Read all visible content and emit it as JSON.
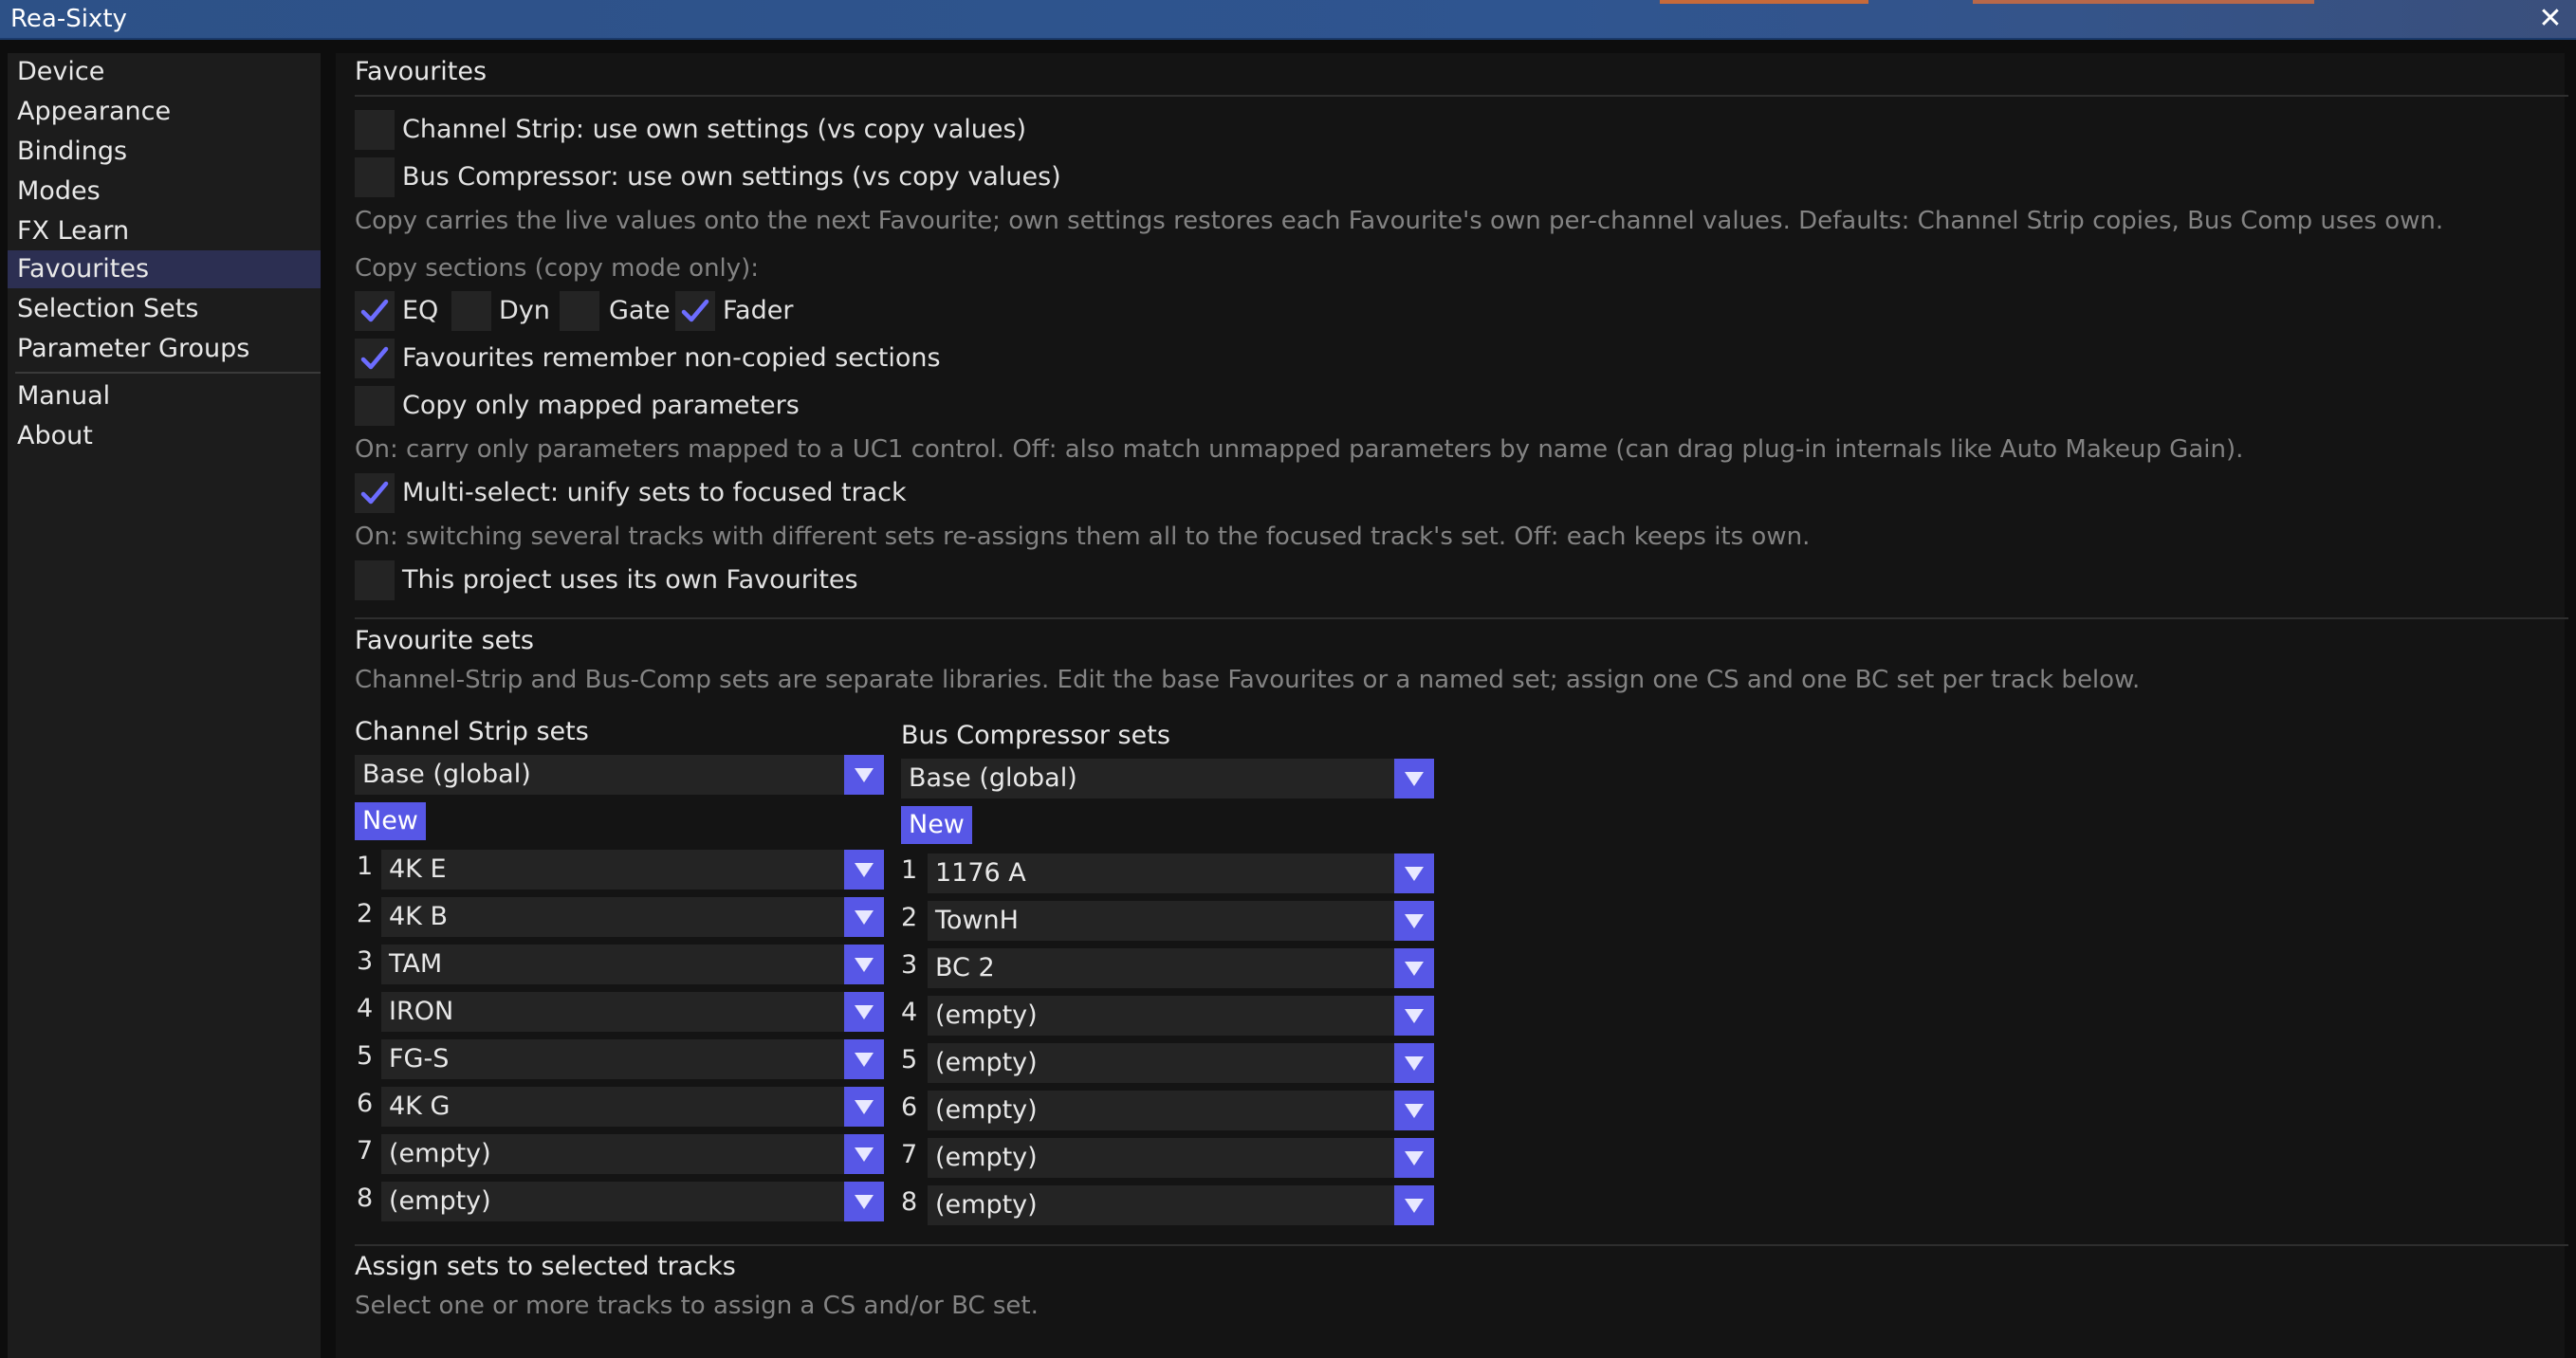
{
  "window": {
    "title": "Rea-Sixty",
    "close": "✕"
  },
  "sidebar": {
    "items": [
      {
        "id": "device",
        "label": "Device"
      },
      {
        "id": "appearance",
        "label": "Appearance"
      },
      {
        "id": "bindings",
        "label": "Bindings"
      },
      {
        "id": "modes",
        "label": "Modes"
      },
      {
        "id": "fx-learn",
        "label": "FX Learn"
      },
      {
        "id": "favourites",
        "label": "Favourites",
        "active": true
      },
      {
        "id": "selection-sets",
        "label": "Selection Sets"
      },
      {
        "id": "parameter-groups",
        "label": "Parameter Groups"
      },
      {
        "id": "manual",
        "label": "Manual"
      },
      {
        "id": "about",
        "label": "About"
      }
    ]
  },
  "favourites": {
    "heading": "Favourites",
    "cs_own": {
      "label": "Channel Strip: use own settings (vs copy values)",
      "checked": false
    },
    "bc_own": {
      "label": "Bus Compressor: use own settings (vs copy values)",
      "checked": false
    },
    "copy_desc": "Copy carries the live values onto the next Favourite; own settings restores each Favourite's own per-channel values. Defaults: Channel Strip copies, Bus Comp uses own.",
    "sections_heading": "Copy sections (copy mode only):",
    "sections": [
      {
        "id": "eq",
        "label": "EQ",
        "checked": true
      },
      {
        "id": "dyn",
        "label": "Dyn",
        "checked": false
      },
      {
        "id": "gate",
        "label": "Gate",
        "checked": false
      },
      {
        "id": "fader",
        "label": "Fader",
        "checked": true
      }
    ],
    "remember_noncopied": {
      "label": "Favourites remember non-copied sections",
      "checked": true
    },
    "copy_mapped_only": {
      "label": "Copy only mapped parameters",
      "checked": false
    },
    "mapped_desc": "On: carry only parameters mapped to a UC1 control. Off: also match unmapped parameters by name (can drag plug-in internals like Auto Makeup Gain).",
    "multiselect": {
      "label": "Multi-select: unify sets to focused track",
      "checked": true
    },
    "multiselect_desc": "On: switching several tracks with different sets re-assigns them all to the focused track's set. Off: each keeps its own.",
    "project_own": {
      "label": "This project uses its own Favourites",
      "checked": false
    }
  },
  "sets": {
    "heading": "Favourite sets",
    "desc": "Channel-Strip and Bus-Comp sets are separate libraries. Edit the base Favourites or a named set; assign one CS and one BC set per track below.",
    "channel_strip": {
      "heading": "Channel Strip sets",
      "selected": "Base (global)",
      "new_label": "New",
      "slots": [
        {
          "num": "1",
          "value": "4K E"
        },
        {
          "num": "2",
          "value": "4K B"
        },
        {
          "num": "3",
          "value": "TAM"
        },
        {
          "num": "4",
          "value": "IRON"
        },
        {
          "num": "5",
          "value": "FG-S"
        },
        {
          "num": "6",
          "value": "4K G"
        },
        {
          "num": "7",
          "value": "(empty)"
        },
        {
          "num": "8",
          "value": "(empty)"
        }
      ]
    },
    "bus_compressor": {
      "heading": "Bus Compressor sets",
      "selected": "Base (global)",
      "new_label": "New",
      "slots": [
        {
          "num": "1",
          "value": "1176 A"
        },
        {
          "num": "2",
          "value": "TownH"
        },
        {
          "num": "3",
          "value": "BC 2"
        },
        {
          "num": "4",
          "value": "(empty)"
        },
        {
          "num": "5",
          "value": "(empty)"
        },
        {
          "num": "6",
          "value": "(empty)"
        },
        {
          "num": "7",
          "value": "(empty)"
        },
        {
          "num": "8",
          "value": "(empty)"
        }
      ]
    }
  },
  "assign": {
    "heading": "Assign sets to selected tracks",
    "desc": "Select one or more tracks to assign a CS and/or BC set."
  },
  "colors": {
    "accent": "#5757e6",
    "titlebar": "#2f5590",
    "nav_active": "#2c2f52"
  }
}
